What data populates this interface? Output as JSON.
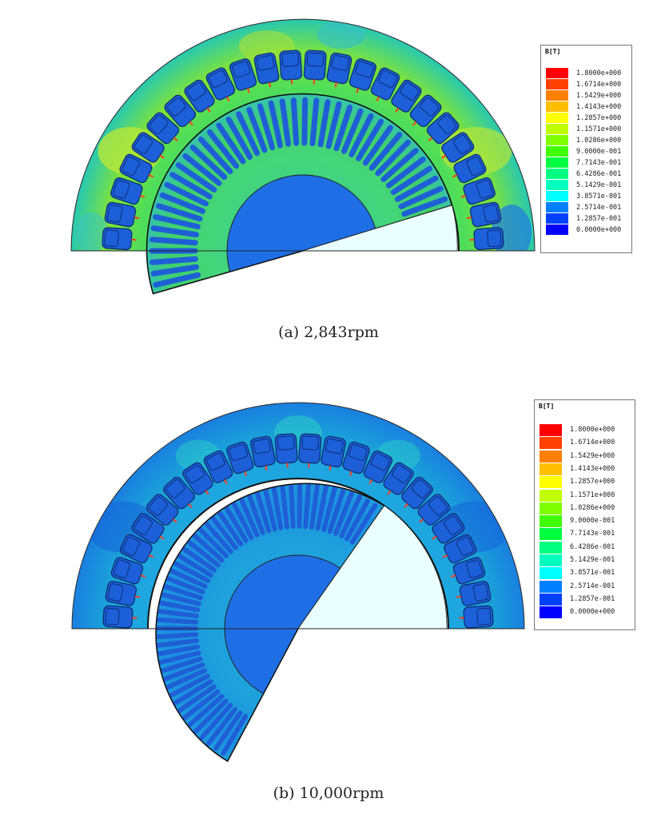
{
  "legend_title": "B[T]",
  "legend_values": [
    "1.8000e+000",
    "1.6714e+000",
    "1.5429e+000",
    "1.4143e+000",
    "1.2857e+000",
    "1.1571e+000",
    "1.0286e+000",
    "9.0000e-001",
    "7.7143e-001",
    "6.4286e-001",
    "5.1429e-001",
    "3.8571e-001",
    "2.5714e-001",
    "1.2857e-001",
    "0.0000e+000"
  ],
  "legend_colors": [
    "#ff0000",
    "#ff4000",
    "#ff8000",
    "#ffbf00",
    "#ffff00",
    "#bfff00",
    "#80ff00",
    "#40ff00",
    "#00ff40",
    "#00ff80",
    "#00ffbf",
    "#00ffff",
    "#0080ff",
    "#0040ff",
    "#0000ff"
  ],
  "panels": [
    {
      "caption": "(a) 2,843rpm",
      "rotor_cut_angle_deg": 17
    },
    {
      "caption": "(b) 10,000rpm",
      "rotor_cut_angle_deg": 55
    }
  ]
}
